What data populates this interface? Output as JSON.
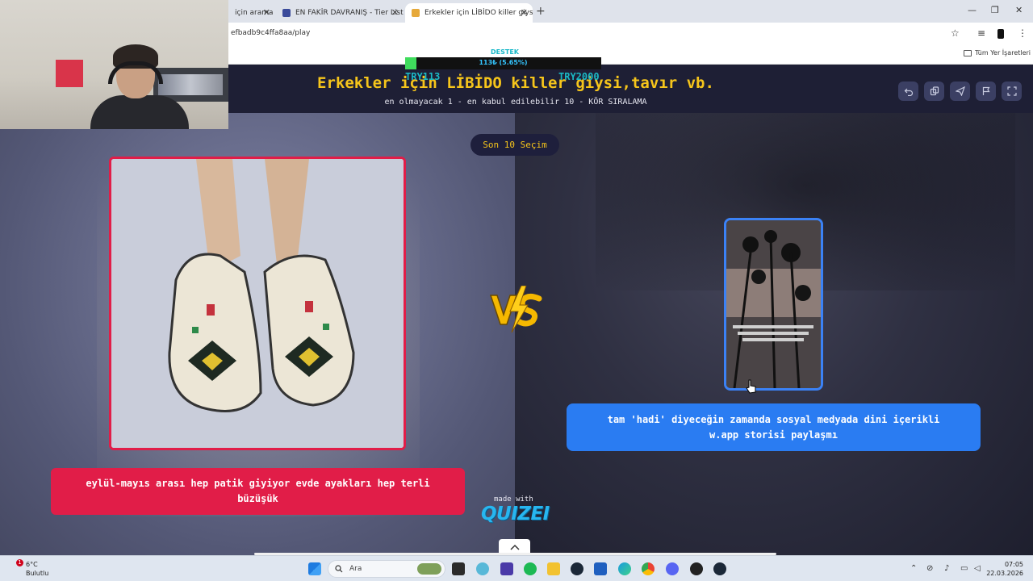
{
  "browser": {
    "tabs": [
      {
        "label": "için arama",
        "active": false
      },
      {
        "label": "EN FAKİR DAVRANIŞ - Tier List",
        "active": false
      },
      {
        "label": "Erkekler için LİBİDO killer giysi,t",
        "active": true
      }
    ],
    "url": "efbadb9c4ffa8aa/play",
    "bookmarks_folder": "Tüm Yer İşaretleri"
  },
  "donation": {
    "title": "DESTEK",
    "progress_text": "113₺ (5.65%)",
    "progress_fraction": 0.0565,
    "current_label": "TRY113",
    "goal_label": "TRY2000"
  },
  "quiz": {
    "title": "Erkekler için LİBİDO killer giysi,tavır vb.",
    "subtitle": "en olmayacak 1 - en kabul edilebilir 10 - KÖR SIRALAMA",
    "round_label": "Son 10 Seçim",
    "left_caption": "eylül-mayıs arası hep patik giyiyor evde ayakları hep terli büzüşük",
    "right_caption": "tam 'hadi' diyeceğin zamanda sosyal medyada dini içerikli w.app storisi paylaşmı",
    "made_with": "made with",
    "brand": "QUIZEI",
    "accent_left": "#e11d48",
    "accent_right": "#2a7cf2",
    "title_color": "#f6c51b"
  },
  "taskbar": {
    "weather_temp": "6°C",
    "weather_desc": "Bulutlu",
    "weather_badge": "1",
    "search_placeholder": "Ara",
    "time": "07:05",
    "date": "22.03.2026"
  }
}
